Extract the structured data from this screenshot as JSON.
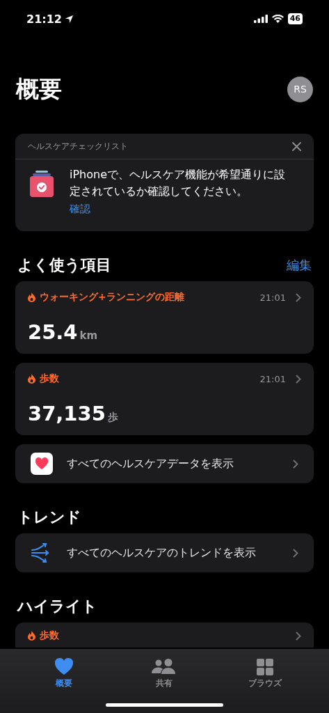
{
  "status_bar": {
    "time": "21:12",
    "battery": "46"
  },
  "header": {
    "title": "概要",
    "avatar": "RS"
  },
  "checklist": {
    "title": "ヘルスケアチェックリスト",
    "message": "iPhoneで、ヘルスケア機能が希望通りに設定されているか確認してください。",
    "action": "確認"
  },
  "favorites": {
    "heading": "よく使う項目",
    "edit": "編集",
    "items": [
      {
        "kind": "metric",
        "title": "ウォーキング+ランニングの距離",
        "time": "21:01",
        "value": "25.4",
        "unit": "km"
      },
      {
        "kind": "metric",
        "title": "歩数",
        "time": "21:01",
        "value": "37,135",
        "unit": "歩"
      },
      {
        "kind": "link",
        "label": "すべてのヘルスケアデータを表示"
      }
    ]
  },
  "trends": {
    "heading": "トレンド",
    "link": "すべてのヘルスケアのトレンドを表示"
  },
  "highlights": {
    "heading": "ハイライト",
    "items": [
      {
        "title": "歩数"
      }
    ]
  },
  "tab_bar": [
    {
      "label": "概要",
      "selected": true
    },
    {
      "label": "共有",
      "selected": false
    },
    {
      "label": "ブラウズ",
      "selected": false
    }
  ]
}
